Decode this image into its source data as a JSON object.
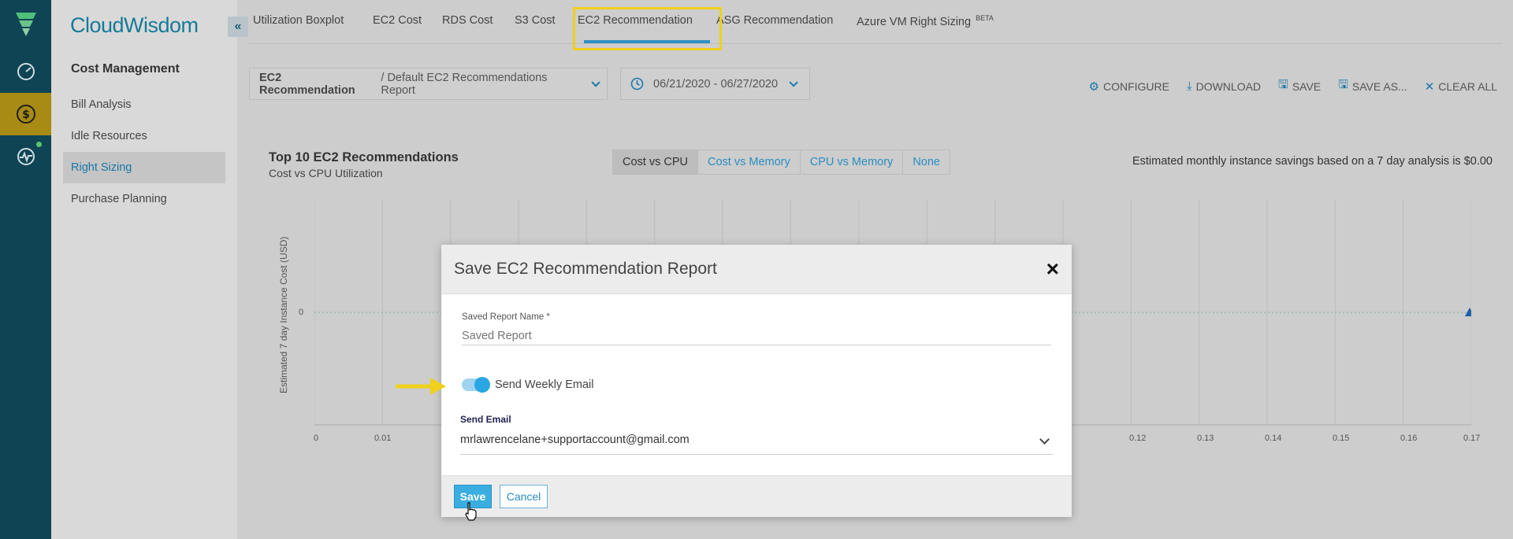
{
  "app": {
    "brand": "CloudWisdom"
  },
  "rail": {
    "items": [
      "dashboard-icon",
      "dollar-icon",
      "pulse-icon"
    ],
    "active": "dollar-icon",
    "accent": "#a88b14"
  },
  "sidebar": {
    "heading": "Cost Management",
    "items": [
      {
        "label": "Bill Analysis"
      },
      {
        "label": "Idle Resources"
      },
      {
        "label": "Right Sizing",
        "active": true
      },
      {
        "label": "Purchase Planning"
      }
    ]
  },
  "tabs": [
    {
      "label": "Utilization Boxplot"
    },
    {
      "label": "EC2 Cost"
    },
    {
      "label": "RDS Cost"
    },
    {
      "label": "S3 Cost"
    },
    {
      "label": "EC2 Recommendation",
      "active": true
    },
    {
      "label": "ASG Recommendation"
    },
    {
      "label": "Azure VM Right Sizing",
      "badge": "BETA"
    }
  ],
  "filters": {
    "report_prefix": "EC2 Recommendation",
    "report_name": "/ Default EC2 Recommendations Report",
    "date_range": "06/21/2020 - 06/27/2020"
  },
  "actions": [
    {
      "icon": "gear-icon",
      "label": "CONFIGURE"
    },
    {
      "icon": "download-icon",
      "label": "DOWNLOAD"
    },
    {
      "icon": "save-icon",
      "label": "SAVE"
    },
    {
      "icon": "save-as-icon",
      "label": "SAVE AS..."
    },
    {
      "icon": "close-icon",
      "label": "CLEAR ALL"
    }
  ],
  "chart": {
    "title": "Top 10 EC2 Recommendations",
    "subtitle": "Cost vs CPU Utilization",
    "toggle_options": [
      "Cost vs CPU",
      "Cost vs Memory",
      "CPU vs Memory",
      "None"
    ],
    "toggle_selected": "Cost vs CPU",
    "savings_text": "Estimated monthly instance savings based on a 7 day analysis is $0.00",
    "ylabel": "Estimated 7 day Instance Cost (USD)",
    "ytick": "0",
    "xticks": [
      "0",
      "0.01",
      "0.12",
      "0.13",
      "0.14",
      "0.15",
      "0.16",
      "0.17"
    ]
  },
  "chart_data": {
    "type": "scatter",
    "title": "Top 10 EC2 Recommendations",
    "subtitle": "Cost vs CPU Utilization",
    "xlabel": "",
    "ylabel": "Estimated 7 day Instance Cost (USD)",
    "xlim": [
      0,
      0.17
    ],
    "points": [
      {
        "x": 0.17,
        "y": 0
      }
    ]
  },
  "modal": {
    "title": "Save EC2 Recommendation Report",
    "name_label": "Saved Report Name *",
    "name_placeholder": "Saved Report",
    "toggle_label": "Send Weekly Email",
    "toggle_on": true,
    "send_email_label": "Send Email",
    "email_value": "mrlawrencelane+supportaccount@gmail.com",
    "save_label": "Save",
    "cancel_label": "Cancel"
  }
}
